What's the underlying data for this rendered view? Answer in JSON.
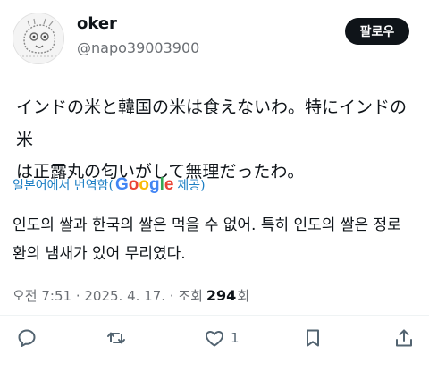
{
  "user": {
    "name": "oker",
    "handle": "@napo39003900",
    "follow_label": "팔로우"
  },
  "tweet": {
    "line1": "インドの米と韓国の米は食えないわ。特にインドの米",
    "line2": "は正露丸の匂いがして無理だったわ。"
  },
  "translation": {
    "prefix": "일본어에서 번역함(",
    "google": [
      "G",
      "o",
      "o",
      "g",
      "l",
      "e"
    ],
    "suffix": " 제공)",
    "line1": "인도의 쌀과 한국의 쌀은 먹을 수 없어. 특히 인도의 쌀은 정로",
    "line2": "환의 냄새가 있어 무리였다."
  },
  "meta": {
    "timestamp": "오전 7:51 · 2025. 4. 17. · 조회",
    "views": "294",
    "views_suffix": "회"
  },
  "actions": {
    "likes": "1"
  },
  "colors": {
    "text": "#0f1419",
    "secondary": "#6b6f74",
    "link": "#1d7fc4",
    "button_bg": "#0f1419"
  },
  "icons": [
    "reply-icon",
    "retweet-icon",
    "like-icon",
    "bookmark-icon",
    "share-icon"
  ]
}
